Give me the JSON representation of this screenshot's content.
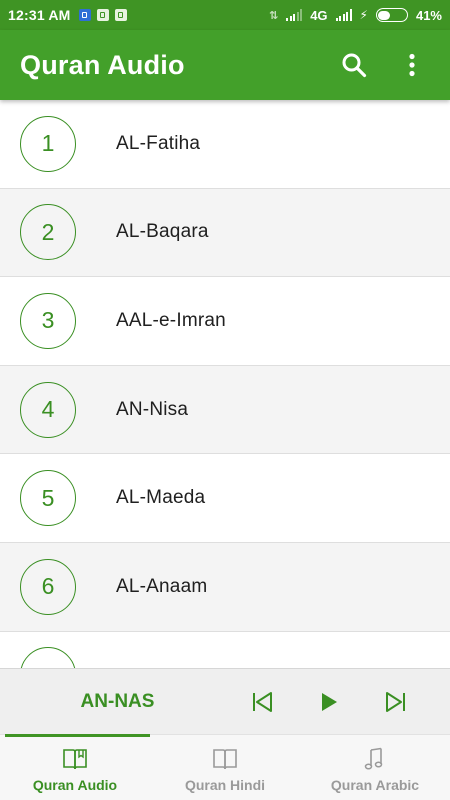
{
  "status_bar": {
    "time": "12:31 AM",
    "network": "4G",
    "battery_percent": "41%",
    "battery_level": 0.41
  },
  "app_bar": {
    "title": "Quran Audio",
    "search_icon": "search-icon",
    "menu_icon": "more-vert-icon"
  },
  "surahs": [
    {
      "number": "1",
      "name": "AL-Fatiha"
    },
    {
      "number": "2",
      "name": "AL-Baqara"
    },
    {
      "number": "3",
      "name": "AAL-e-Imran"
    },
    {
      "number": "4",
      "name": "AN-Nisa"
    },
    {
      "number": "5",
      "name": "AL-Maeda"
    },
    {
      "number": "6",
      "name": "AL-Anaam"
    },
    {
      "number": "",
      "name": ""
    }
  ],
  "player": {
    "now_playing": "AN-NAS",
    "prev_icon": "skip-previous-icon",
    "play_icon": "play-icon",
    "next_icon": "skip-next-icon"
  },
  "bottom_nav": {
    "items": [
      {
        "label": "Quran Audio",
        "icon": "book-icon",
        "active": true
      },
      {
        "label": "Quran Hindi",
        "icon": "open-book-icon",
        "active": false
      },
      {
        "label": "Quran Arabic",
        "icon": "music-note-icon",
        "active": false
      }
    ]
  },
  "colors": {
    "primary": "#43a02a",
    "status_bar": "#3f9424",
    "accent_text": "#3a8f23",
    "inactive_nav": "#9a9a9a"
  }
}
